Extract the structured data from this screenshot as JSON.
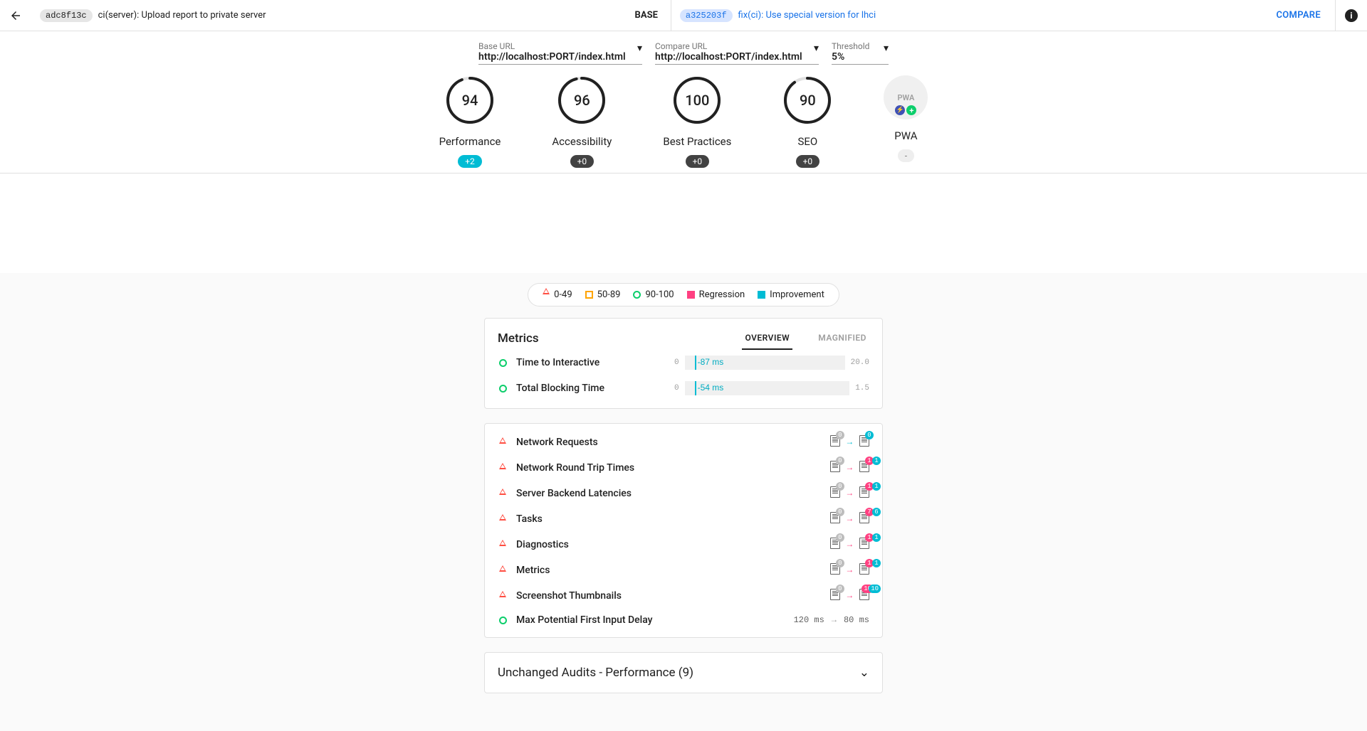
{
  "header": {
    "base_hash": "adc8f13c",
    "base_msg": "ci(server): Upload report to private server",
    "base_label": "BASE",
    "cmp_hash": "a325203f",
    "cmp_msg": "fix(ci): Use special version for lhci",
    "compare_btn": "COMPARE"
  },
  "fields": {
    "base_url": {
      "label": "Base URL",
      "value": "http://localhost:PORT/index.html"
    },
    "compare_url": {
      "label": "Compare URL",
      "value": "http://localhost:PORT/index.html"
    },
    "threshold": {
      "label": "Threshold",
      "value": "5%"
    }
  },
  "gauges": [
    {
      "score": "94",
      "label": "Performance",
      "delta": "+2",
      "delta_class": "imp"
    },
    {
      "score": "96",
      "label": "Accessibility",
      "delta": "+0",
      "delta_class": ""
    },
    {
      "score": "100",
      "label": "Best Practices",
      "delta": "+0",
      "delta_class": ""
    },
    {
      "score": "90",
      "label": "SEO",
      "delta": "+0",
      "delta_class": ""
    },
    {
      "score": "PWA",
      "label": "PWA",
      "delta": "-",
      "delta_class": "na",
      "pwa": true
    }
  ],
  "legend": {
    "l0": "0-49",
    "l1": "50-89",
    "l2": "90-100",
    "l3": "Regression",
    "l4": "Improvement"
  },
  "metrics": {
    "title": "Metrics",
    "tab_overview": "OVERVIEW",
    "tab_magnified": "MAGNIFIED",
    "rows": [
      {
        "name": "Time to Interactive",
        "min": "0",
        "max": "20.0",
        "delta": "-87 ms"
      },
      {
        "name": "Total Blocking Time",
        "min": "0",
        "max": "1.5",
        "delta": "-54 ms"
      }
    ]
  },
  "audits": [
    {
      "name": "Network Requests",
      "status": "fail",
      "left_badge": "0",
      "left_badge_cls": "gray",
      "right_badge1": "0",
      "right_badge1_cls": "cyan",
      "arrow": "cyan"
    },
    {
      "name": "Network Round Trip Times",
      "status": "fail",
      "left_badge": "0",
      "left_badge_cls": "gray",
      "right_badge1": "1",
      "right_badge1_cls": "pink",
      "right_badge2": "1",
      "right_badge2_cls": "cyan",
      "arrow": "pink"
    },
    {
      "name": "Server Backend Latencies",
      "status": "fail",
      "left_badge": "0",
      "left_badge_cls": "gray",
      "right_badge1": "1",
      "right_badge1_cls": "pink",
      "right_badge2": "1",
      "right_badge2_cls": "cyan",
      "arrow": "pink"
    },
    {
      "name": "Tasks",
      "status": "fail",
      "left_badge": "0",
      "left_badge_cls": "gray",
      "right_badge1": "7",
      "right_badge1_cls": "pink",
      "right_badge2": "6",
      "right_badge2_cls": "cyan",
      "arrow": "pink"
    },
    {
      "name": "Diagnostics",
      "status": "fail",
      "left_badge": "0",
      "left_badge_cls": "gray",
      "right_badge1": "1",
      "right_badge1_cls": "pink",
      "right_badge2": "1",
      "right_badge2_cls": "cyan",
      "arrow": "pink"
    },
    {
      "name": "Metrics",
      "status": "fail",
      "left_badge": "0",
      "left_badge_cls": "gray",
      "right_badge1": "1",
      "right_badge1_cls": "pink",
      "right_badge2": "1",
      "right_badge2_cls": "cyan",
      "arrow": "pink"
    },
    {
      "name": "Screenshot Thumbnails",
      "status": "fail",
      "left_badge": "0",
      "left_badge_cls": "gray",
      "right_badge1": "10",
      "right_badge1_cls": "pink",
      "right_badge2": "10",
      "right_badge2_cls": "cyan",
      "arrow": "pink"
    },
    {
      "name": "Max Potential First Input Delay",
      "status": "pass",
      "text_left": "120 ms",
      "text_right": "80 ms",
      "arrow": "gray"
    }
  ],
  "unchanged": {
    "title": "Unchanged Audits - Performance (9)"
  }
}
